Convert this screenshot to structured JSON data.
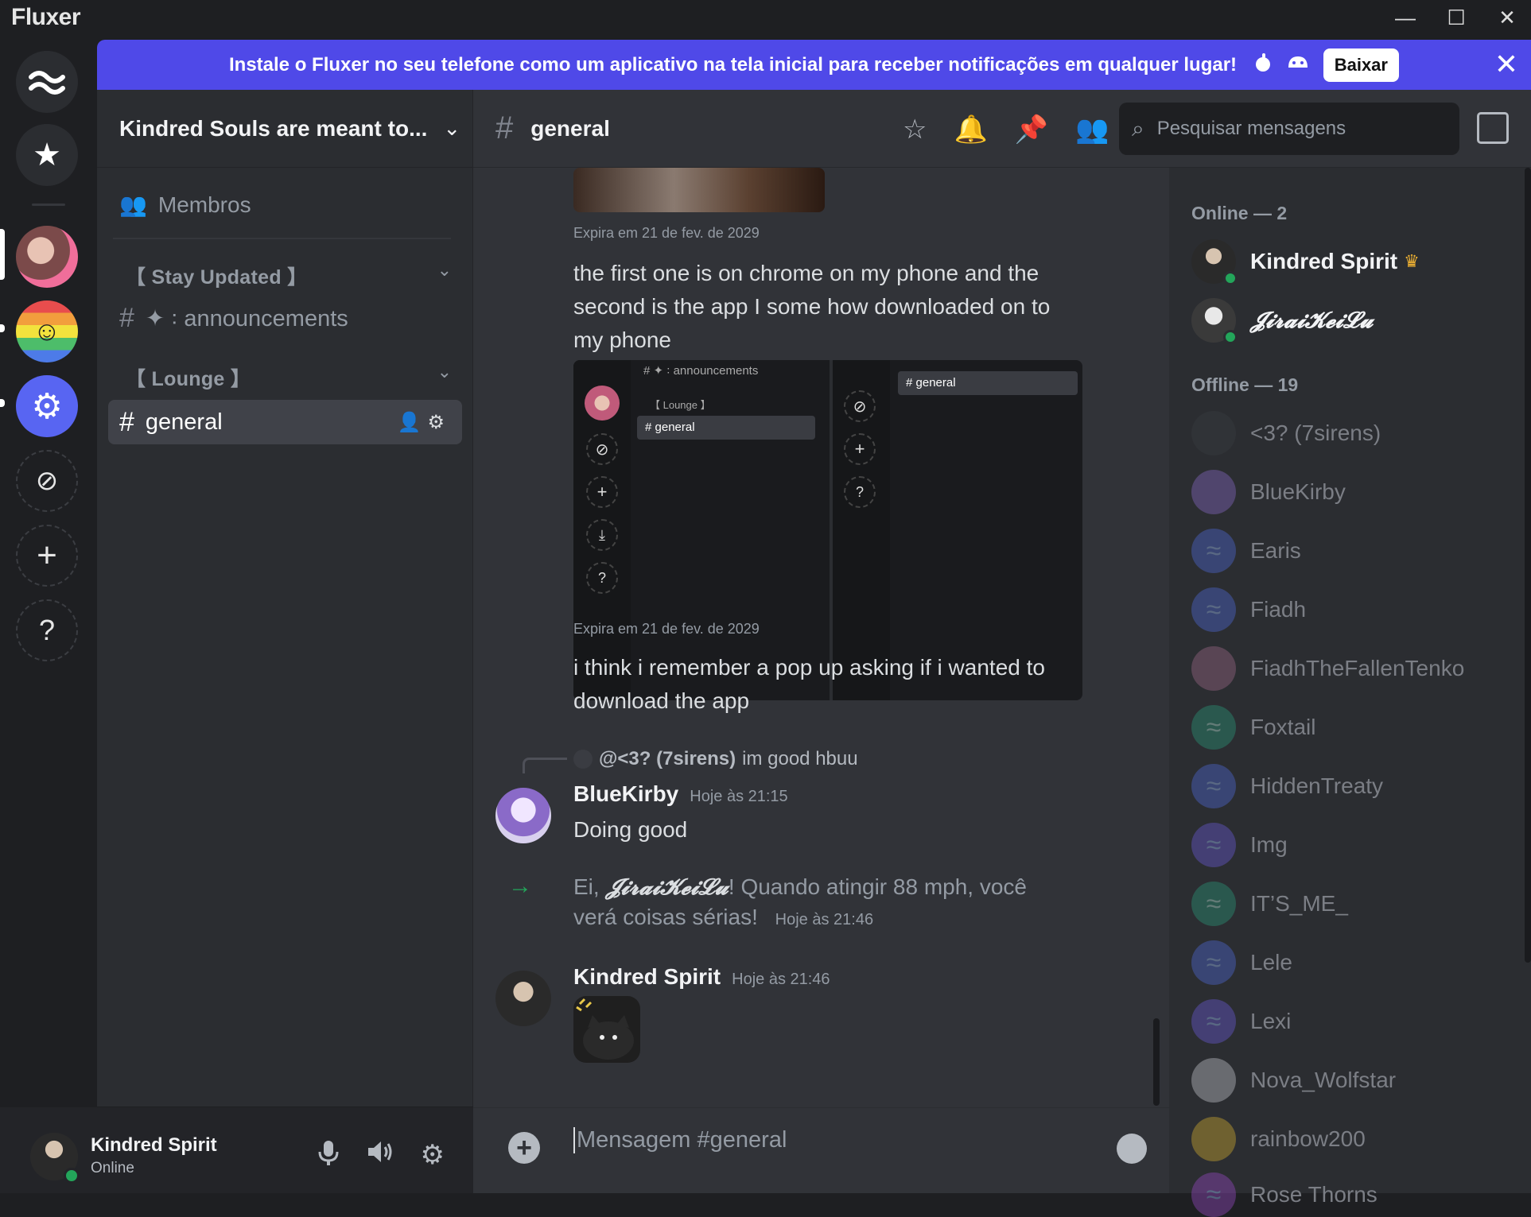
{
  "app": {
    "title": "Fluxer"
  },
  "window": {
    "minimize": "—",
    "maximize": "☐",
    "close": "✕"
  },
  "banner": {
    "text": "Instale o Fluxer no seu telefone como um aplicativo na tela inicial para receber notificações em qualquer lugar!",
    "platform_icons": "",
    "download_label": "Baixar",
    "close": "✕"
  },
  "guild": {
    "name": "Kindred Souls are meant to...",
    "chevron": "⌄"
  },
  "sidebar": {
    "members_label": "Membros",
    "categories": [
      {
        "label": "【 Stay Updated 】",
        "chevron": "⌄"
      },
      {
        "label": "【 Lounge 】",
        "chevron": "⌄"
      }
    ],
    "channels": [
      {
        "hash": "#",
        "label": "✦ ꞉ announcements"
      },
      {
        "hash": "#",
        "label": "general"
      }
    ],
    "active_actions": "👤⚙"
  },
  "user": {
    "name": "Kindred Spirit",
    "status": "Online"
  },
  "channel": {
    "hash": "#",
    "name": "general",
    "search_placeholder": "Pesquisar mensagens",
    "composer_placeholder": "Mensagem #general",
    "plus": "+"
  },
  "messages": {
    "expires1": "Expira em 21 de fev. de 2029",
    "text1": "the first one is on chrome on my phone and the second is the app I some how downloaded on to my phone",
    "embed": {
      "chan1": "# ✦ ꞉ announcements",
      "cat": "【 Lounge 】",
      "chan2": "# general",
      "chan3": "# general",
      "cat_top": "【 Lounge 】"
    },
    "expires2": "Expira em 21 de fev. de 2029",
    "text2": "i think i remember a pop up asking if i wanted to download the app",
    "reply_to": "@<3? (7sirens)",
    "reply_text": "im good hbuu",
    "msg3": {
      "author": "BlueKirby",
      "time": "Hoje às 21:15",
      "text": "Doing good"
    },
    "system": {
      "prefix": "Ei, ",
      "mention": "𝓙𝓲𝓻𝓪𝓲𝓚𝓮𝓲𝓛𝓾",
      "suffix": "! Quando atingir 88 mph, você verá coisas sérias!",
      "time": "Hoje às 21:46"
    },
    "msg4": {
      "author": "Kindred Spirit",
      "time": "Hoje às 21:46"
    }
  },
  "members_list": {
    "online_header": "Online — 2",
    "offline_header": "Offline — 19",
    "online": [
      {
        "name": "Kindred Spirit",
        "crown": "♛"
      },
      {
        "name": "𝓙𝓲𝓻𝓪𝓲𝓚𝓮𝓲𝓛𝓾"
      }
    ],
    "offline": [
      {
        "name": "<3? (7sirens)"
      },
      {
        "name": "BlueKirby"
      },
      {
        "name": "Earis"
      },
      {
        "name": "Fiadh"
      },
      {
        "name": "FiadhTheFallenTenko"
      },
      {
        "name": "Foxtail"
      },
      {
        "name": "HiddenTreaty"
      },
      {
        "name": "Img"
      },
      {
        "name": "IT’S_ME_"
      },
      {
        "name": "Lele"
      },
      {
        "name": "Lexi"
      },
      {
        "name": "Nova_Wolfstar"
      },
      {
        "name": "rainbow200"
      },
      {
        "name": "Rose Thorns"
      }
    ]
  },
  "colors": {
    "accent": "#4f49e8",
    "online": "#23a55a",
    "crown": "#f0b232"
  }
}
